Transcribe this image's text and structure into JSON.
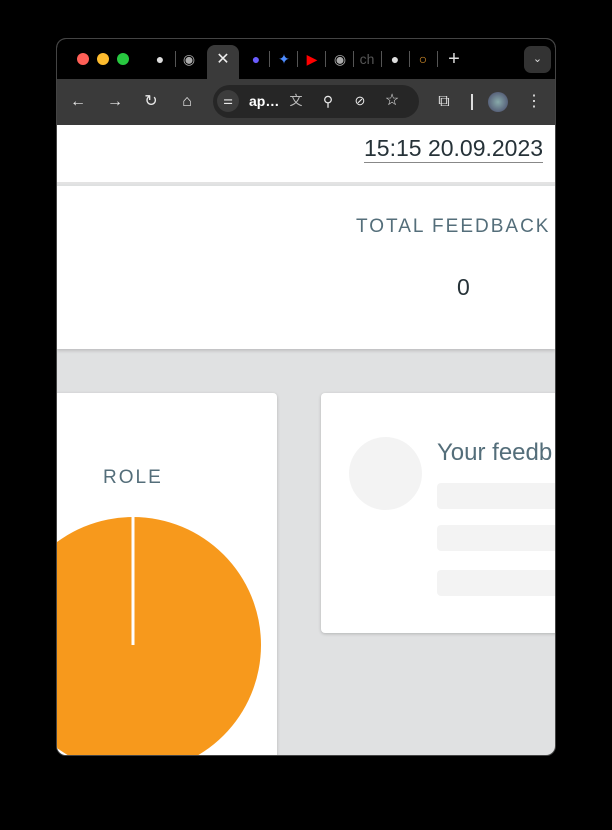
{
  "browser": {
    "tabs": [
      {
        "icon": "github-icon"
      },
      {
        "icon": "globe-icon"
      },
      {
        "icon": "close-icon",
        "active": true
      },
      {
        "icon": "q-icon"
      },
      {
        "icon": "sparkle-icon"
      },
      {
        "icon": "youtube-icon"
      },
      {
        "icon": "globe-icon"
      },
      {
        "icon": "ch-icon",
        "label": "ch"
      },
      {
        "icon": "github-check-icon"
      },
      {
        "icon": "circle-icon"
      }
    ],
    "address": "ap…"
  },
  "header": {
    "datetime": "15:15 20.09.2023"
  },
  "stats": {
    "label": "TOTAL FEEDBACK",
    "value": "0"
  },
  "role_card": {
    "title": "ROLE"
  },
  "feedback_card": {
    "title": "Your feedb"
  },
  "colors": {
    "pie": "#f7991c",
    "label": "#546e7a"
  },
  "chart_data": {
    "type": "pie",
    "title": "ROLE",
    "values": [
      100
    ]
  }
}
